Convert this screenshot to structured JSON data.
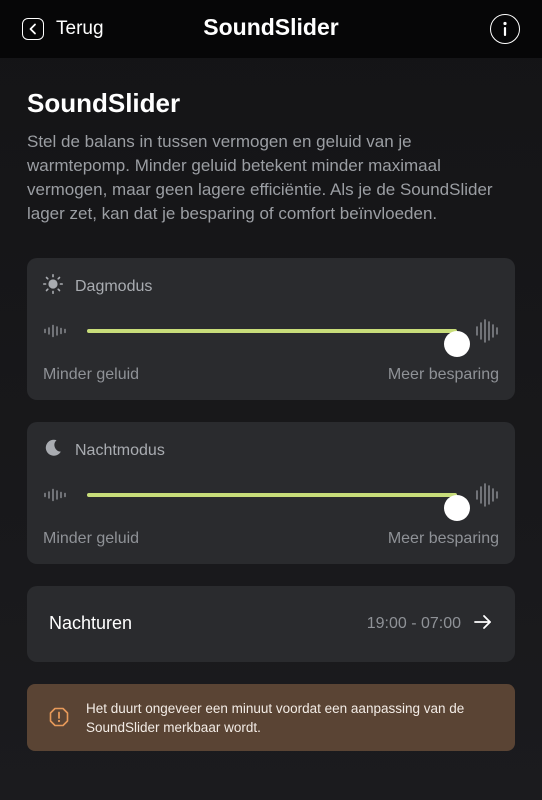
{
  "header": {
    "back_label": "Terug",
    "title": "SoundSlider"
  },
  "main": {
    "title": "SoundSlider",
    "description": "Stel de balans in tussen vermogen en geluid van je warmtepomp. Minder geluid betekent minder maximaal vermogen, maar geen lagere efficiëntie. Als je de SoundSlider lager zet, kan dat je besparing of comfort beïnvloeden."
  },
  "day_mode": {
    "label": "Dagmodus",
    "icon": "sun-icon",
    "level": 1.0,
    "min_label": "Minder geluid",
    "max_label": "Meer besparing"
  },
  "night_mode": {
    "label": "Nachtmodus",
    "icon": "moon-icon",
    "level": 1.0,
    "min_label": "Minder geluid",
    "max_label": "Meer besparing"
  },
  "night_hours": {
    "label": "Nachturen",
    "value": "19:00 - 07:00"
  },
  "notice": {
    "text": "Het duurt ongeveer een minuut voordat een aanpassing van de SoundSlider merkbaar wordt.",
    "icon": "warning-icon"
  },
  "colors": {
    "accent": "#c8dd7a",
    "card": "#2a2b2e",
    "notice_bg": "#5a4434",
    "notice_icon": "#e79a5a"
  }
}
